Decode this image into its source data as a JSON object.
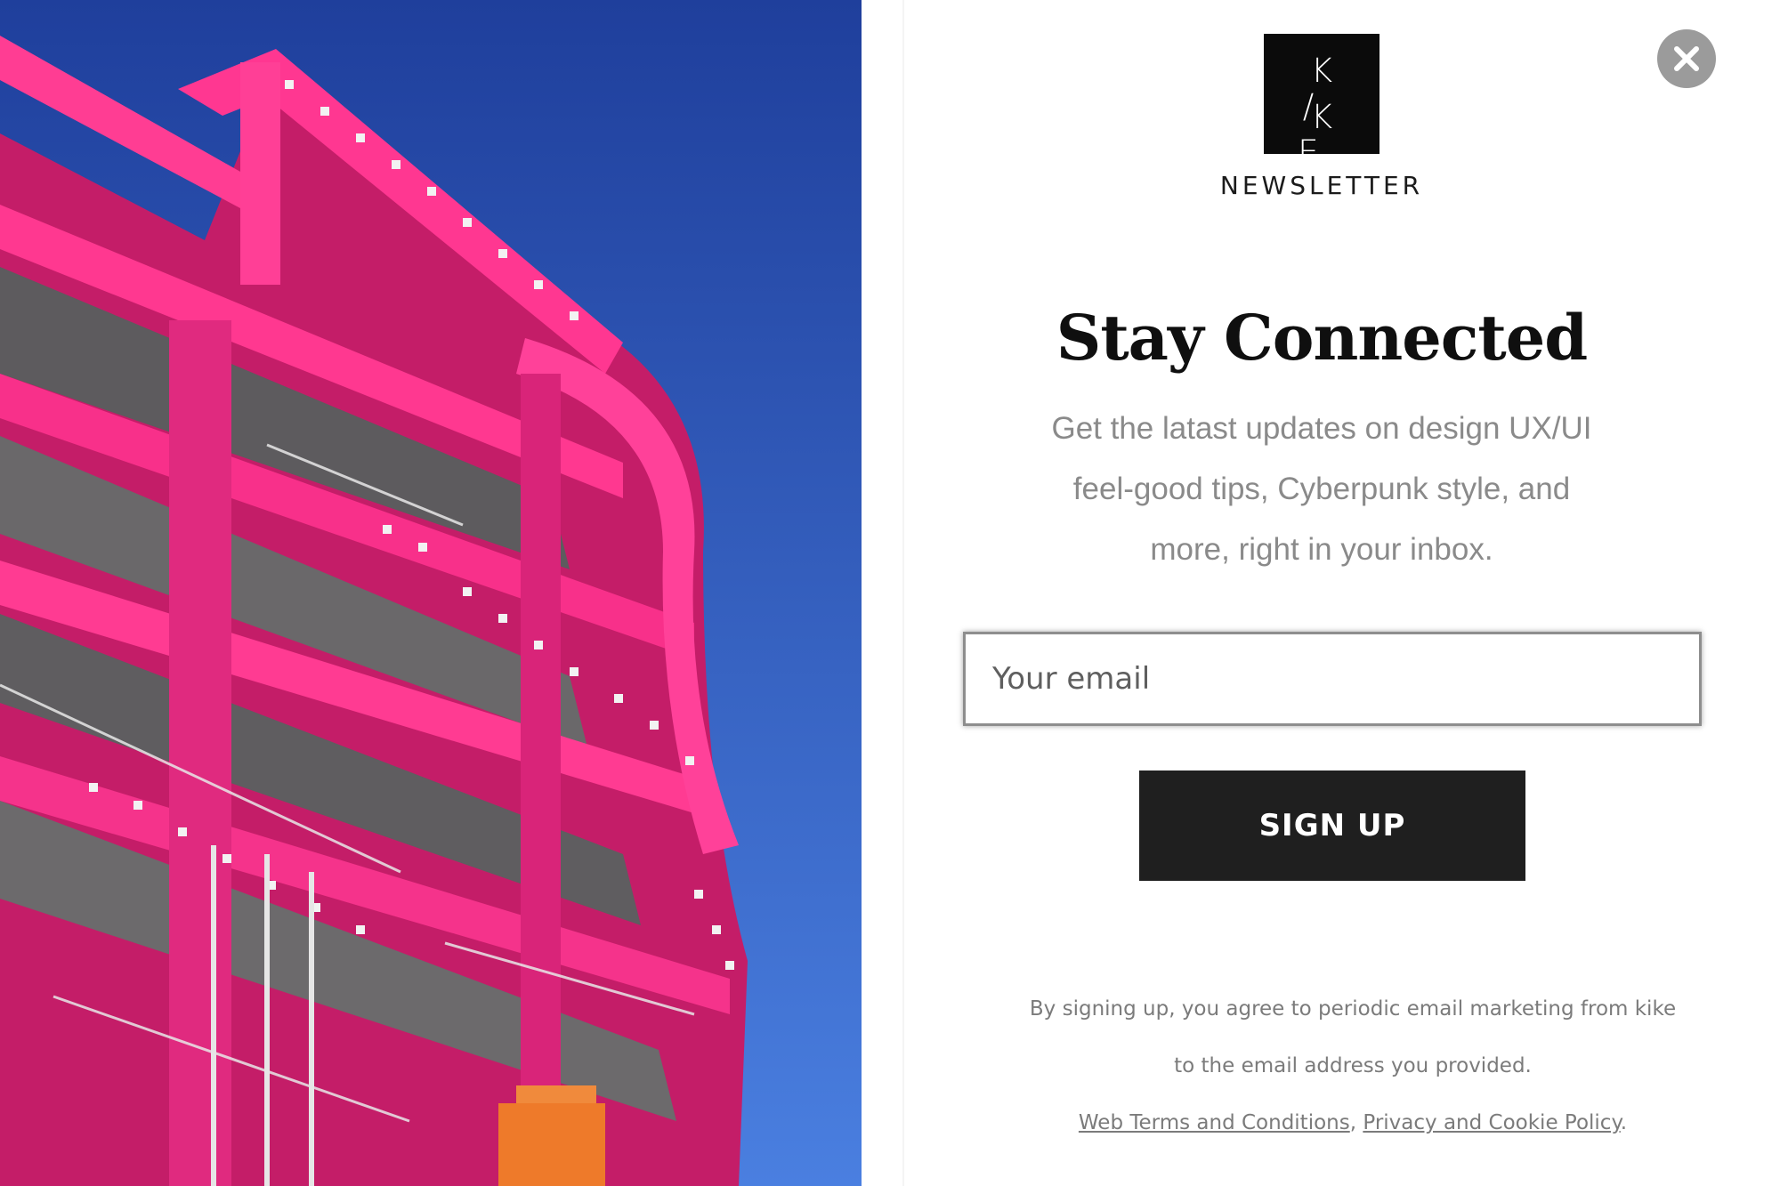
{
  "hero": {
    "icon": "pink-building-photo",
    "colors": {
      "sky": "#3d6bd0",
      "structure": "#e8297f"
    }
  },
  "close_button": {
    "icon": "close-icon",
    "color": "#9b9b9b"
  },
  "logo": {
    "line1": "K /",
    "line2": "K E"
  },
  "newsletter_label": "NEWSLETTER",
  "headline": "Stay Connected",
  "subtext": {
    "line1": "Get the latast updates on design UX/UI",
    "line2": "feel-good tips, Cyberpunk style, and",
    "line3": "more, right in your inbox."
  },
  "email_field": {
    "placeholder": "Your email",
    "value": ""
  },
  "signup_button": {
    "label": "SIGN UP",
    "color": "#1f1f1f"
  },
  "consent": {
    "line1": "By signing up, you agree to periodic email marketing from kike",
    "line2": "to the email address you provided.",
    "terms_link": "Web Terms and Conditions",
    "separator": ",",
    "privacy_link": "Privacy and Cookie Policy",
    "end": "."
  }
}
